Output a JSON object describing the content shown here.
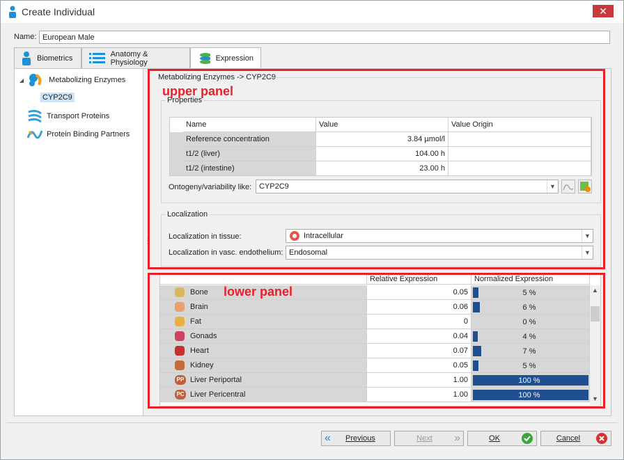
{
  "window": {
    "title": "Create Individual"
  },
  "name_field": {
    "label": "Name:",
    "value": "European Male"
  },
  "tabs": [
    {
      "label": "Biometrics",
      "icon": "person-icon"
    },
    {
      "label": "Anatomy & Physiology",
      "icon": "list-icon"
    },
    {
      "label": "Expression",
      "icon": "expression-icon"
    }
  ],
  "tree": {
    "root": "Metabolizing Enzymes",
    "selected_child": "CYP2C9",
    "items": [
      "Transport Proteins",
      "Protein Binding Partners"
    ]
  },
  "upper": {
    "breadcrumb": "Metabolizing Enzymes -> CYP2C9",
    "annotation": "upper panel",
    "properties_caption": "Properties",
    "columns": [
      "Name",
      "Value",
      "Value Origin"
    ],
    "rows": [
      {
        "name": "Reference concentration",
        "value": "3.84 µmol/l",
        "origin": ""
      },
      {
        "name": "t1/2 (liver)",
        "value": "104.00 h",
        "origin": ""
      },
      {
        "name": "t1/2 (intestine)",
        "value": "23.00 h",
        "origin": ""
      }
    ],
    "ontogeny_label": "Ontogeny/variability like:",
    "ontogeny_value": "CYP2C9",
    "localization_caption": "Localization",
    "tissue_label": "Localization in tissue:",
    "tissue_value": "Intracellular",
    "vasc_label": "Localization in vasc. endothelium:",
    "vasc_value": "Endosomal"
  },
  "lower": {
    "annotation": "lower panel",
    "columns": [
      "Relative Expression",
      "Normalized Expression"
    ],
    "rows": [
      {
        "organ": "Bone",
        "rel": "0.05",
        "norm": "5 %",
        "frac": 0.05,
        "icon": "bone-icon"
      },
      {
        "organ": "Brain",
        "rel": "0.06",
        "norm": "6 %",
        "frac": 0.06,
        "icon": "brain-icon"
      },
      {
        "organ": "Fat",
        "rel": "0",
        "norm": "0 %",
        "frac": 0.0,
        "icon": "fat-icon"
      },
      {
        "organ": "Gonads",
        "rel": "0.04",
        "norm": "4 %",
        "frac": 0.04,
        "icon": "gonads-icon"
      },
      {
        "organ": "Heart",
        "rel": "0.07",
        "norm": "7 %",
        "frac": 0.07,
        "icon": "heart-icon"
      },
      {
        "organ": "Kidney",
        "rel": "0.05",
        "norm": "5 %",
        "frac": 0.05,
        "icon": "kidney-icon"
      },
      {
        "organ": "Liver Periportal",
        "rel": "1.00",
        "norm": "100 %",
        "frac": 1.0,
        "icon": "liver-pp-icon",
        "badge": "PP"
      },
      {
        "organ": "Liver Pericentral",
        "rel": "1.00",
        "norm": "100 %",
        "frac": 1.0,
        "icon": "liver-pc-icon",
        "badge": "PC"
      }
    ]
  },
  "footer": {
    "previous": "Previous",
    "next": "Next",
    "ok": "OK",
    "cancel": "Cancel"
  },
  "colors": {
    "annotation": "#e8202a",
    "bar": "#1f4e91"
  }
}
